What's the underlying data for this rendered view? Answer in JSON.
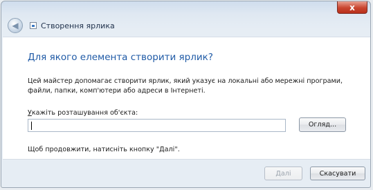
{
  "window": {
    "title": "Створення ярлика",
    "close_glyph": "x"
  },
  "main": {
    "heading": "Для якого елемента створити ярлик?",
    "description": "Цей майстер допомагає створити ярлик, який указує на локальні або мережні програми, файли, папки, комп'ютери або адреси в Інтернеті.",
    "location_label_accel": "У",
    "location_label_rest": "кажіть розташування об'єкта:",
    "location_value": "",
    "browse_label": "Огляд...",
    "hint": "Щоб продовжити, натисніть кнопку \"Далі\"."
  },
  "footer": {
    "next_label": "Далі",
    "cancel_label": "Скасувати"
  },
  "icons": {
    "back": "back-arrow-icon",
    "wizard": "shortcut-wizard-icon",
    "close": "close-icon"
  },
  "colors": {
    "heading": "#1f5aa6",
    "close_button": "#c9452f",
    "window_frame": "#dfe8f2"
  }
}
